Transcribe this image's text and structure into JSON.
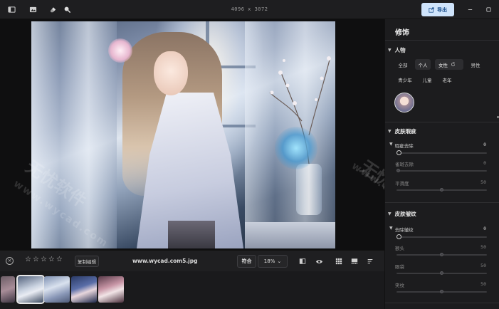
{
  "toolbar": {
    "icons": [
      "sidebar-icon",
      "image-icon",
      "eraser-icon",
      "zoom-icon"
    ],
    "dimensions": "4096 x 3072",
    "export_label": "导出"
  },
  "watermark": {
    "text_cn": "无忧软件",
    "text_url": "www.wycad.com"
  },
  "bottom": {
    "stars": [
      "☆",
      "☆",
      "☆",
      "☆",
      "☆"
    ],
    "copy_edit_label": "复制编辑",
    "filename": "www.wycad.com5.jpg",
    "fit_label": "符合",
    "zoom": "18%",
    "chevron": "⌄"
  },
  "panel": {
    "title": "修饰",
    "people": {
      "heading": "人物",
      "chips": [
        {
          "label": "全部"
        },
        {
          "label": "个人"
        },
        {
          "label": "女性"
        },
        {
          "label": "男性"
        },
        {
          "label": "青少年"
        },
        {
          "label": "儿童"
        },
        {
          "label": "老年"
        }
      ]
    },
    "skin_blemish": {
      "heading": "皮肤瑕疵",
      "sliders": [
        {
          "label": "瑕疵去除",
          "value": "0",
          "level": 0
        },
        {
          "label": "雀斑去除",
          "value": "0",
          "level": 0
        },
        {
          "label": "平滑度",
          "value": "50",
          "level": 50
        }
      ]
    },
    "skin_wrinkle": {
      "heading": "皮肤皱纹",
      "sliders": [
        {
          "label": "去除皱纹",
          "value": "0",
          "level": 0
        },
        {
          "label": "额头",
          "value": "50",
          "level": 50
        },
        {
          "label": "眼袋",
          "value": "50",
          "level": 50
        },
        {
          "label": "笑纹",
          "value": "50",
          "level": 50
        }
      ]
    }
  },
  "colors": {
    "export_bg": "#cfe4fb",
    "export_text": "#1b4f8c",
    "panel_bg": "#1c1c1e"
  }
}
